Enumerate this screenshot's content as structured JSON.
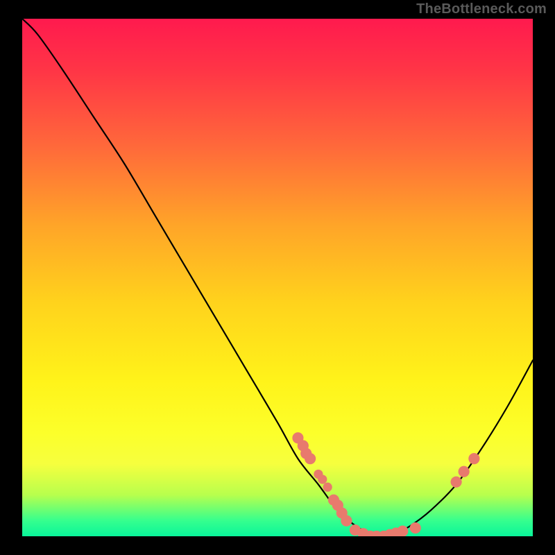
{
  "watermark": "TheBottleneck.com",
  "colors": {
    "page_bg": "#000000",
    "marker": "#e87a6d",
    "curve": "#000000",
    "gradient_top": "#ff1a4e",
    "gradient_bottom": "#09f59a"
  },
  "chart_data": {
    "type": "line",
    "title": "",
    "xlabel": "",
    "ylabel": "",
    "xlim": [
      0,
      100
    ],
    "ylim": [
      0,
      100
    ],
    "grid": false,
    "legend": false,
    "annotation": "TheBottleneck.com",
    "series": [
      {
        "name": "curve",
        "x": [
          0,
          3,
          8,
          14,
          20,
          26,
          32,
          38,
          44,
          50,
          54,
          58,
          61,
          64,
          67,
          70,
          73,
          76,
          80,
          85,
          90,
          95,
          100
        ],
        "values": [
          100,
          97,
          90,
          81,
          72,
          62,
          52,
          42,
          32,
          22,
          15,
          10,
          6,
          3,
          1,
          0,
          0.5,
          2,
          5,
          10,
          17,
          25,
          34
        ]
      }
    ],
    "markers": [
      {
        "x": 54.0,
        "y": 19.0,
        "r": 1.1
      },
      {
        "x": 55.0,
        "y": 17.5,
        "r": 1.1
      },
      {
        "x": 55.6,
        "y": 16.0,
        "r": 1.1
      },
      {
        "x": 56.4,
        "y": 15.0,
        "r": 1.1
      },
      {
        "x": 58.0,
        "y": 12.0,
        "r": 0.9
      },
      {
        "x": 58.8,
        "y": 11.0,
        "r": 0.9
      },
      {
        "x": 59.8,
        "y": 9.5,
        "r": 0.9
      },
      {
        "x": 61.0,
        "y": 7.0,
        "r": 1.1
      },
      {
        "x": 61.8,
        "y": 6.0,
        "r": 1.1
      },
      {
        "x": 62.6,
        "y": 4.5,
        "r": 1.1
      },
      {
        "x": 63.5,
        "y": 3.0,
        "r": 1.1
      },
      {
        "x": 65.2,
        "y": 1.2,
        "r": 1.1
      },
      {
        "x": 66.8,
        "y": 0.5,
        "r": 1.1
      },
      {
        "x": 68.2,
        "y": 0.0,
        "r": 1.1
      },
      {
        "x": 69.4,
        "y": 0.0,
        "r": 1.1
      },
      {
        "x": 70.8,
        "y": 0.0,
        "r": 1.1
      },
      {
        "x": 72.0,
        "y": 0.3,
        "r": 1.1
      },
      {
        "x": 73.2,
        "y": 0.6,
        "r": 1.1
      },
      {
        "x": 74.5,
        "y": 1.0,
        "r": 1.1
      },
      {
        "x": 77.0,
        "y": 1.6,
        "r": 1.1
      },
      {
        "x": 85.0,
        "y": 10.5,
        "r": 1.1
      },
      {
        "x": 86.5,
        "y": 12.5,
        "r": 1.1
      },
      {
        "x": 88.5,
        "y": 15.0,
        "r": 1.1
      }
    ]
  }
}
